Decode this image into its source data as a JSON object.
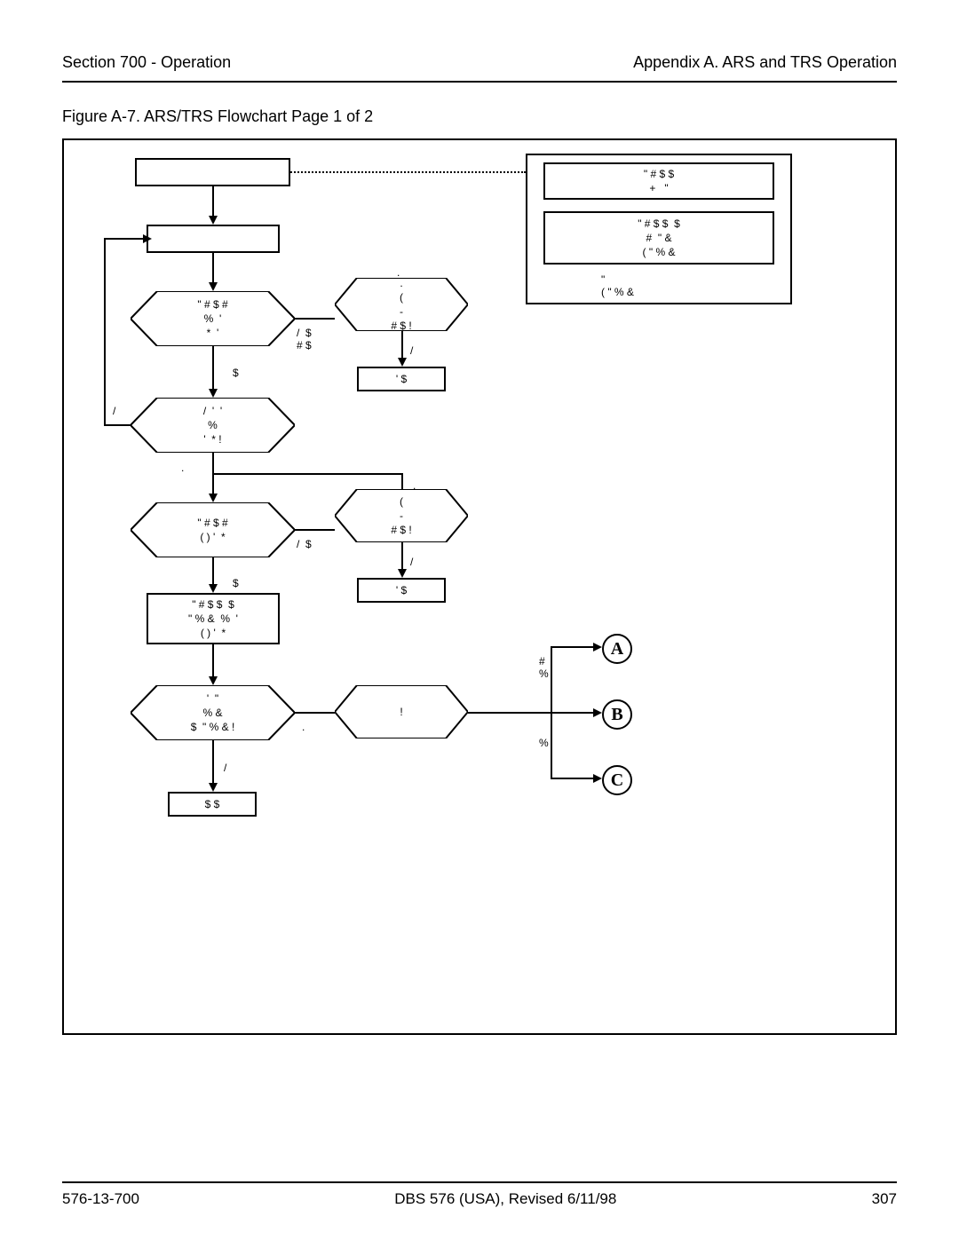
{
  "header": {
    "left": "Section 700 - Operation",
    "right": "Appendix A. ARS and TRS Operation"
  },
  "caption": "Figure A-7.  ARS/TRS Flowchart Page 1 of 2",
  "footer": {
    "left": "576-13-700",
    "center": "DBS 576 (USA), Revised 6/11/98",
    "right": "307"
  },
  "nodes": {
    "start": "",
    "key1": "\" # $ $\n+   \"",
    "key2": "\" # $ $  $\n#  \" &\n( \" % &",
    "keynote": "\"\n( \" % &",
    "step1": "",
    "dec1": "\" # $ #\n%  '\n*  '",
    "dec1yes": "$",
    "dec1no": "/  $\n# $",
    "dec1rt": ".\n(\n-\n# $ !",
    "dec1rtyes": "/",
    "term1": "' $",
    "dec2": "/  '  '\n%\n'  * !",
    "dec2dot": ".",
    "dec3": "\" # $ #\n( ) '  *",
    "dec3yes": "$",
    "dec3no": "/  $",
    "dec3dot": ".",
    "dec3rt": "(\n-\n# $ !",
    "dec3rtyes": "/",
    "term2": "' $",
    "proc": "\" # $ $  $\n\" % &  %  '\n( ) '  *",
    "dec4": "'  \"\n% &\n$  \" % & !",
    "dec4dot": ".",
    "dec4yes": "/",
    "dec4rt": "!",
    "term3": "$ $",
    "connA_lbl": "#\n%",
    "connB_lbl": "%",
    "A": "A",
    "B": "B",
    "C": "C"
  }
}
